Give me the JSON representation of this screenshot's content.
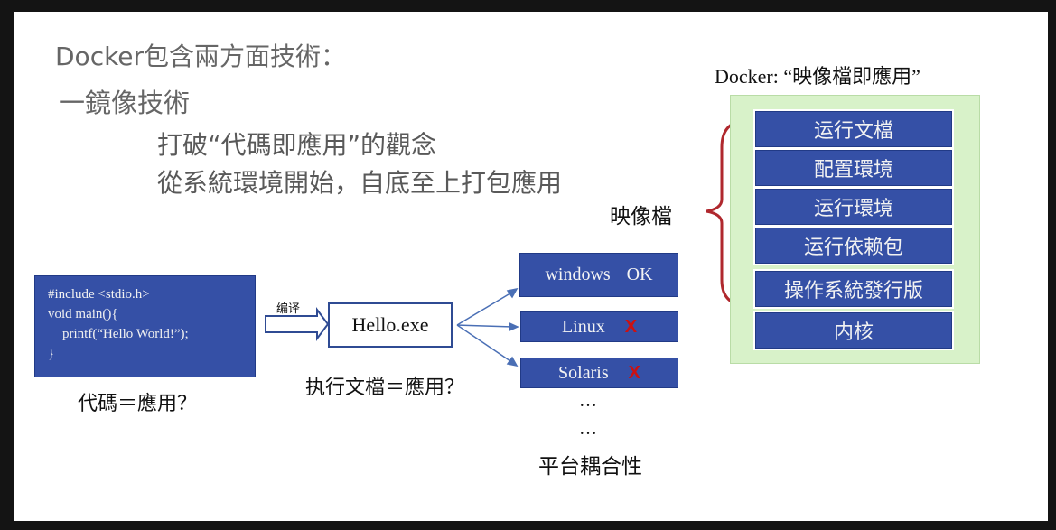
{
  "slide": {
    "title": "Docker包含兩方面技術：",
    "point1": "一鏡像技術",
    "sub1": "打破“代碼即應用”的觀念",
    "sub2": "從系統環境開始，自底至上打包應用"
  },
  "code": {
    "line1": "#include <stdio.h>",
    "line2": "void main(){",
    "line3": "printf(“Hello World!”);",
    "line4": "}",
    "caption": "代碼＝應用？"
  },
  "compile_label": "编译",
  "exe": {
    "name": "Hello.exe",
    "caption": "执行文檔＝應用？"
  },
  "platforms": {
    "items": [
      {
        "name": "windows",
        "status": "OK"
      },
      {
        "name": "Linux",
        "status": "X"
      },
      {
        "name": "Solaris",
        "status": "X"
      }
    ],
    "ellipsis1": "…",
    "ellipsis2": "…",
    "caption": "平台耦合性"
  },
  "docker": {
    "title": "Docker: “映像檔即應用”",
    "bracket_label": "映像檔",
    "layers": [
      "运行文檔",
      "配置環境",
      "运行環境",
      "运行依赖包",
      "操作系統發行版",
      "内核"
    ]
  },
  "colors": {
    "box_blue": "#3550a6",
    "panel_green": "#d8f2c9",
    "bracket_red": "#b0282e",
    "x_red": "#cc1111"
  }
}
